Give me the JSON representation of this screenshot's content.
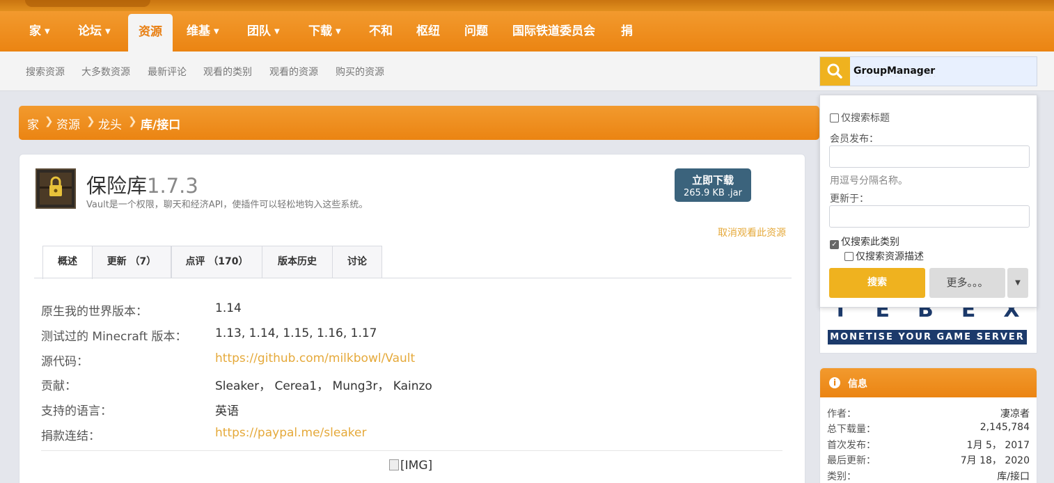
{
  "nav": {
    "items": [
      {
        "label": "家",
        "caret": true
      },
      {
        "label": "论坛",
        "caret": true
      },
      {
        "label": "资源",
        "caret": false,
        "active": true
      },
      {
        "label": "维基",
        "caret": true
      },
      {
        "label": "团队",
        "caret": true
      },
      {
        "label": "下载",
        "caret": true
      },
      {
        "label": "不和",
        "caret": false
      },
      {
        "label": "枢纽",
        "caret": false
      },
      {
        "label": "问题",
        "caret": false
      },
      {
        "label": "国际铁道委员会",
        "caret": false
      },
      {
        "label": "捐",
        "caret": false
      }
    ]
  },
  "subnav": {
    "items": [
      "搜索资源",
      "大多数资源",
      "最新评论",
      "观看的类别",
      "观看的资源",
      "购买的资源"
    ]
  },
  "search": {
    "value": "GroupManager"
  },
  "breadcrumb": [
    "家",
    "资源",
    "龙头",
    "库/接口"
  ],
  "resource": {
    "name": "保险库",
    "version": "1.7.3",
    "tagline": "Vault是一个权限，聊天和经济API，使插件可以轻松地钩入这些系统。",
    "download_label": "立即下载",
    "download_size": "265.9 KB .jar",
    "unwatch": "取消观看此资源"
  },
  "tabs": [
    "概述",
    "更新 （7）",
    "点评 （170）",
    "版本历史",
    "讨论"
  ],
  "info_rows": [
    {
      "label": "原生我的世界版本：",
      "value": "1.14",
      "link": false
    },
    {
      "label": "测试过的 Minecraft 版本：",
      "value": "1.13, 1.14, 1.15, 1.16, 1.17",
      "link": false
    },
    {
      "label": "源代码：",
      "value": "https://github.com/milkbowl/Vault",
      "link": true
    },
    {
      "label": "贡献：",
      "value": "Sleaker， Cerea1， Mung3r， Kainzo",
      "link": false
    },
    {
      "label": "支持的语言：",
      "value": "英语",
      "link": false
    },
    {
      "label": "捐款连结：",
      "value": "https://paypal.me/sleaker",
      "link": true
    }
  ],
  "image_placeholder": "[IMG]",
  "search_popup": {
    "title_only": "仅搜索标题",
    "posted_by_label": "会员发布：",
    "names_hint": "用逗号分隔名称。",
    "updated_since_label": "更新于：",
    "this_category": "仅搜索此类别",
    "description_only": "仅搜索资源描述",
    "search_btn": "搜索",
    "more_btn": "更多。。。"
  },
  "ad": {
    "letters": "TEBEX",
    "tagline": "MONETISE YOUR GAME SERVER"
  },
  "info_card": {
    "title": "信息",
    "rows": [
      {
        "k": "作者：",
        "v": "凄凉者"
      },
      {
        "k": "总下载量：",
        "v": "2,145,784"
      },
      {
        "k": "首次发布：",
        "v": "1月 5， 2017"
      },
      {
        "k": "最后更新：",
        "v": "7月 18， 2020"
      },
      {
        "k": "类别：",
        "v": "库/接口"
      }
    ]
  },
  "colors": {
    "accent": "#eb8412",
    "link": "#e5a93a",
    "download": "#3b637c",
    "search_btn": "#efb21f"
  }
}
